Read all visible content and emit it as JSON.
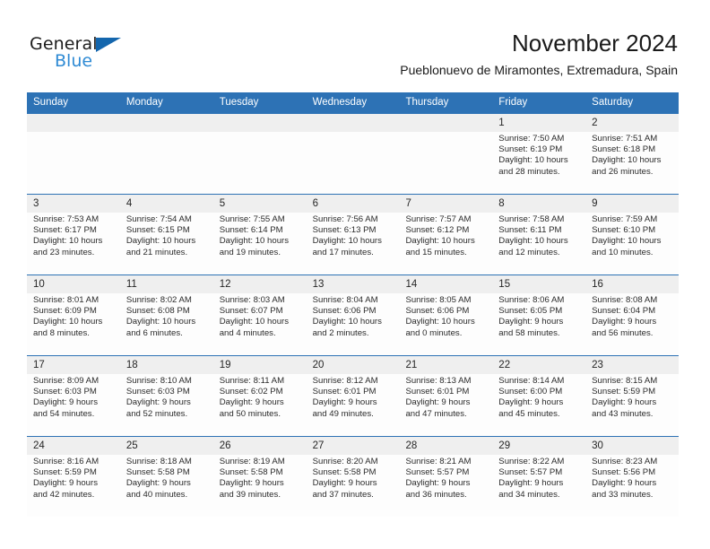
{
  "brand": {
    "name_part1": "General",
    "name_part2": "Blue",
    "accent_color": "#2e8ad4",
    "triangle_color": "#1466ad"
  },
  "header": {
    "title": "November 2024",
    "subtitle": "Pueblonuevo de Miramontes, Extremadura, Spain"
  },
  "theme": {
    "header_blue": "#2d72b5",
    "date_strip_gray": "#efefef",
    "cell_background": "#fdfdfd"
  },
  "weekday_headers": [
    "Sunday",
    "Monday",
    "Tuesday",
    "Wednesday",
    "Thursday",
    "Friday",
    "Saturday"
  ],
  "labels": {
    "sunrise_prefix": "Sunrise:",
    "sunset_prefix": "Sunset:",
    "daylight_prefix": "Daylight:"
  },
  "weeks": [
    [
      {
        "day": "",
        "empty": true
      },
      {
        "day": "",
        "empty": true
      },
      {
        "day": "",
        "empty": true
      },
      {
        "day": "",
        "empty": true
      },
      {
        "day": "",
        "empty": true
      },
      {
        "day": "1",
        "sunrise": "Sunrise: 7:50 AM",
        "sunset": "Sunset: 6:19 PM",
        "daylight_l1": "Daylight: 10 hours",
        "daylight_l2": "and 28 minutes."
      },
      {
        "day": "2",
        "sunrise": "Sunrise: 7:51 AM",
        "sunset": "Sunset: 6:18 PM",
        "daylight_l1": "Daylight: 10 hours",
        "daylight_l2": "and 26 minutes."
      }
    ],
    [
      {
        "day": "3",
        "sunrise": "Sunrise: 7:53 AM",
        "sunset": "Sunset: 6:17 PM",
        "daylight_l1": "Daylight: 10 hours",
        "daylight_l2": "and 23 minutes."
      },
      {
        "day": "4",
        "sunrise": "Sunrise: 7:54 AM",
        "sunset": "Sunset: 6:15 PM",
        "daylight_l1": "Daylight: 10 hours",
        "daylight_l2": "and 21 minutes."
      },
      {
        "day": "5",
        "sunrise": "Sunrise: 7:55 AM",
        "sunset": "Sunset: 6:14 PM",
        "daylight_l1": "Daylight: 10 hours",
        "daylight_l2": "and 19 minutes."
      },
      {
        "day": "6",
        "sunrise": "Sunrise: 7:56 AM",
        "sunset": "Sunset: 6:13 PM",
        "daylight_l1": "Daylight: 10 hours",
        "daylight_l2": "and 17 minutes."
      },
      {
        "day": "7",
        "sunrise": "Sunrise: 7:57 AM",
        "sunset": "Sunset: 6:12 PM",
        "daylight_l1": "Daylight: 10 hours",
        "daylight_l2": "and 15 minutes."
      },
      {
        "day": "8",
        "sunrise": "Sunrise: 7:58 AM",
        "sunset": "Sunset: 6:11 PM",
        "daylight_l1": "Daylight: 10 hours",
        "daylight_l2": "and 12 minutes."
      },
      {
        "day": "9",
        "sunrise": "Sunrise: 7:59 AM",
        "sunset": "Sunset: 6:10 PM",
        "daylight_l1": "Daylight: 10 hours",
        "daylight_l2": "and 10 minutes."
      }
    ],
    [
      {
        "day": "10",
        "sunrise": "Sunrise: 8:01 AM",
        "sunset": "Sunset: 6:09 PM",
        "daylight_l1": "Daylight: 10 hours",
        "daylight_l2": "and 8 minutes."
      },
      {
        "day": "11",
        "sunrise": "Sunrise: 8:02 AM",
        "sunset": "Sunset: 6:08 PM",
        "daylight_l1": "Daylight: 10 hours",
        "daylight_l2": "and 6 minutes."
      },
      {
        "day": "12",
        "sunrise": "Sunrise: 8:03 AM",
        "sunset": "Sunset: 6:07 PM",
        "daylight_l1": "Daylight: 10 hours",
        "daylight_l2": "and 4 minutes."
      },
      {
        "day": "13",
        "sunrise": "Sunrise: 8:04 AM",
        "sunset": "Sunset: 6:06 PM",
        "daylight_l1": "Daylight: 10 hours",
        "daylight_l2": "and 2 minutes."
      },
      {
        "day": "14",
        "sunrise": "Sunrise: 8:05 AM",
        "sunset": "Sunset: 6:06 PM",
        "daylight_l1": "Daylight: 10 hours",
        "daylight_l2": "and 0 minutes."
      },
      {
        "day": "15",
        "sunrise": "Sunrise: 8:06 AM",
        "sunset": "Sunset: 6:05 PM",
        "daylight_l1": "Daylight: 9 hours",
        "daylight_l2": "and 58 minutes."
      },
      {
        "day": "16",
        "sunrise": "Sunrise: 8:08 AM",
        "sunset": "Sunset: 6:04 PM",
        "daylight_l1": "Daylight: 9 hours",
        "daylight_l2": "and 56 minutes."
      }
    ],
    [
      {
        "day": "17",
        "sunrise": "Sunrise: 8:09 AM",
        "sunset": "Sunset: 6:03 PM",
        "daylight_l1": "Daylight: 9 hours",
        "daylight_l2": "and 54 minutes."
      },
      {
        "day": "18",
        "sunrise": "Sunrise: 8:10 AM",
        "sunset": "Sunset: 6:03 PM",
        "daylight_l1": "Daylight: 9 hours",
        "daylight_l2": "and 52 minutes."
      },
      {
        "day": "19",
        "sunrise": "Sunrise: 8:11 AM",
        "sunset": "Sunset: 6:02 PM",
        "daylight_l1": "Daylight: 9 hours",
        "daylight_l2": "and 50 minutes."
      },
      {
        "day": "20",
        "sunrise": "Sunrise: 8:12 AM",
        "sunset": "Sunset: 6:01 PM",
        "daylight_l1": "Daylight: 9 hours",
        "daylight_l2": "and 49 minutes."
      },
      {
        "day": "21",
        "sunrise": "Sunrise: 8:13 AM",
        "sunset": "Sunset: 6:01 PM",
        "daylight_l1": "Daylight: 9 hours",
        "daylight_l2": "and 47 minutes."
      },
      {
        "day": "22",
        "sunrise": "Sunrise: 8:14 AM",
        "sunset": "Sunset: 6:00 PM",
        "daylight_l1": "Daylight: 9 hours",
        "daylight_l2": "and 45 minutes."
      },
      {
        "day": "23",
        "sunrise": "Sunrise: 8:15 AM",
        "sunset": "Sunset: 5:59 PM",
        "daylight_l1": "Daylight: 9 hours",
        "daylight_l2": "and 43 minutes."
      }
    ],
    [
      {
        "day": "24",
        "sunrise": "Sunrise: 8:16 AM",
        "sunset": "Sunset: 5:59 PM",
        "daylight_l1": "Daylight: 9 hours",
        "daylight_l2": "and 42 minutes."
      },
      {
        "day": "25",
        "sunrise": "Sunrise: 8:18 AM",
        "sunset": "Sunset: 5:58 PM",
        "daylight_l1": "Daylight: 9 hours",
        "daylight_l2": "and 40 minutes."
      },
      {
        "day": "26",
        "sunrise": "Sunrise: 8:19 AM",
        "sunset": "Sunset: 5:58 PM",
        "daylight_l1": "Daylight: 9 hours",
        "daylight_l2": "and 39 minutes."
      },
      {
        "day": "27",
        "sunrise": "Sunrise: 8:20 AM",
        "sunset": "Sunset: 5:58 PM",
        "daylight_l1": "Daylight: 9 hours",
        "daylight_l2": "and 37 minutes."
      },
      {
        "day": "28",
        "sunrise": "Sunrise: 8:21 AM",
        "sunset": "Sunset: 5:57 PM",
        "daylight_l1": "Daylight: 9 hours",
        "daylight_l2": "and 36 minutes."
      },
      {
        "day": "29",
        "sunrise": "Sunrise: 8:22 AM",
        "sunset": "Sunset: 5:57 PM",
        "daylight_l1": "Daylight: 9 hours",
        "daylight_l2": "and 34 minutes."
      },
      {
        "day": "30",
        "sunrise": "Sunrise: 8:23 AM",
        "sunset": "Sunset: 5:56 PM",
        "daylight_l1": "Daylight: 9 hours",
        "daylight_l2": "and 33 minutes."
      }
    ]
  ]
}
